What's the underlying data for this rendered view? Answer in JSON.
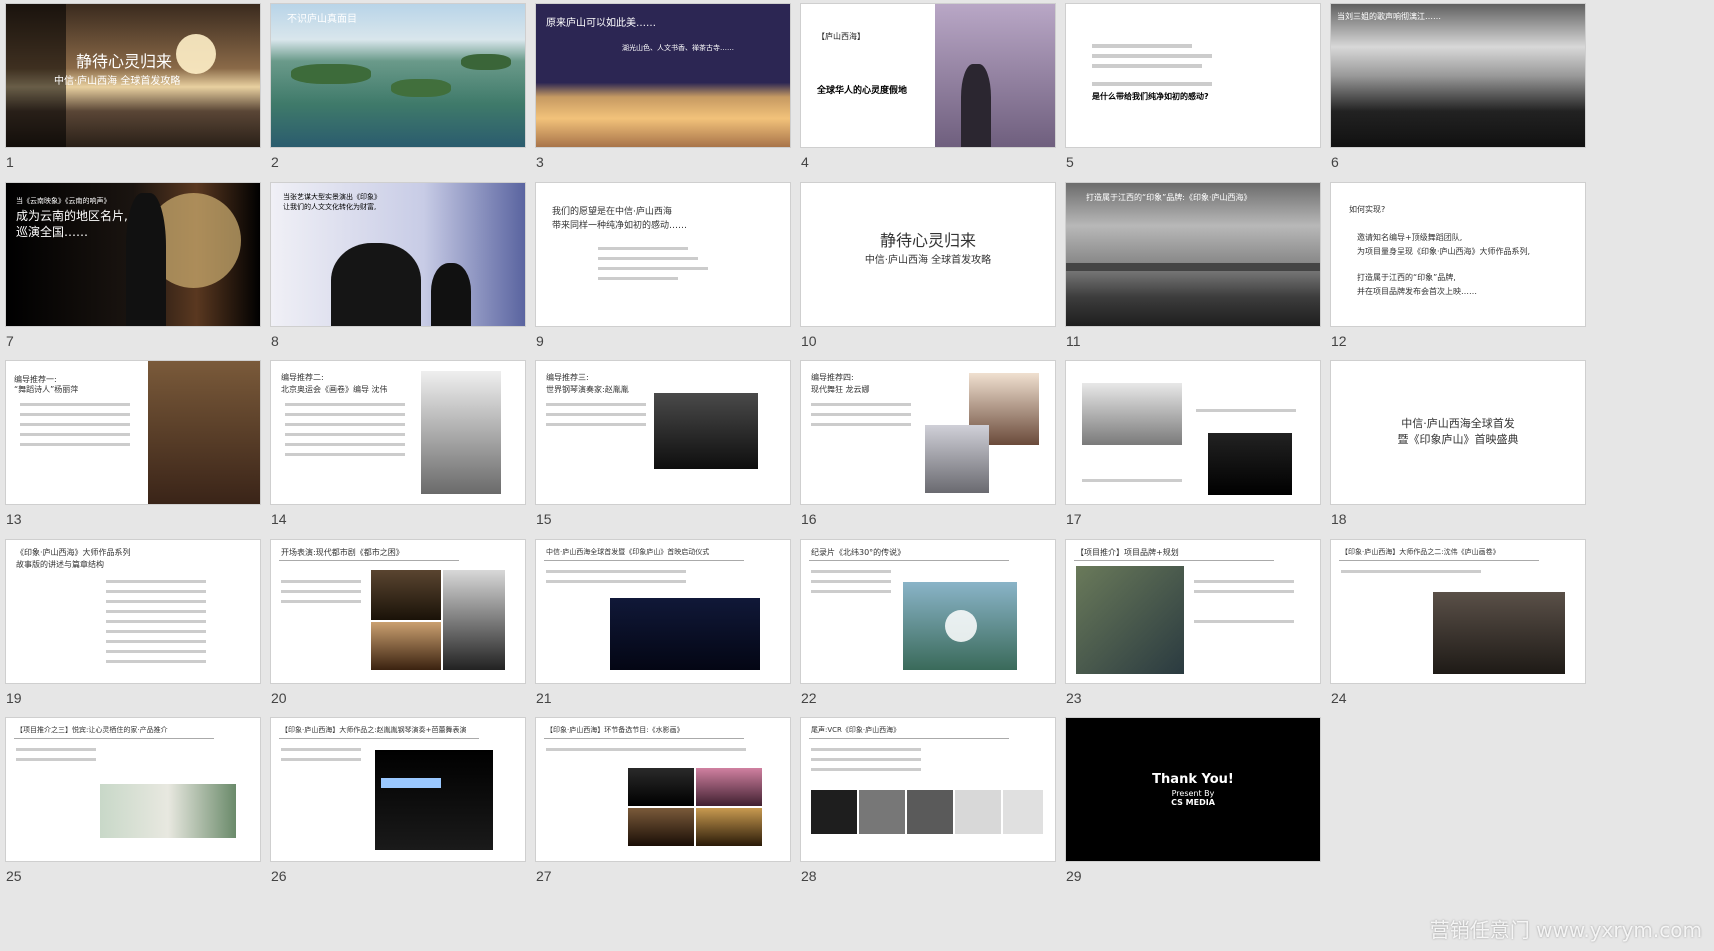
{
  "watermark": "营销任意门 www.yxrym.com",
  "slides": [
    {
      "num": "1",
      "texts": [
        "静待心灵归来",
        "中信·庐山西海 全球首发攻略"
      ]
    },
    {
      "num": "2",
      "texts": [
        "不识庐山真面目"
      ]
    },
    {
      "num": "3",
      "texts": [
        "原来庐山可以如此美……",
        "湖光山色、人文书香、禅茶古寺……"
      ]
    },
    {
      "num": "4",
      "texts": [
        "【庐山西海】",
        "全球华人的心灵度假地"
      ]
    },
    {
      "num": "5",
      "texts": [
        "是什么带给我们纯净如初的感动?"
      ]
    },
    {
      "num": "6",
      "texts": [
        "当刘三姐的歌声响彻漓江……"
      ]
    },
    {
      "num": "7",
      "texts": [
        "当《云南映象》《云南的响声》",
        "成为云南的地区名片,",
        "巡演全国……"
      ]
    },
    {
      "num": "8",
      "texts": [
        "当张艺谋大型实景演出《印象》",
        "让我们的人文文化转化为财富,"
      ]
    },
    {
      "num": "9",
      "texts": [
        "我们的愿望是在中信·庐山西海",
        "带来同样一种纯净如初的感动……"
      ]
    },
    {
      "num": "10",
      "texts": [
        "静待心灵归来",
        "中信·庐山西海 全球首发攻略"
      ]
    },
    {
      "num": "11",
      "texts": [
        "打造属于江西的“印象”品牌:《印象·庐山西海》"
      ]
    },
    {
      "num": "12",
      "texts": [
        "如何实现?",
        "邀请知名编导+顶级舞蹈团队,",
        "为项目量身呈现《印象·庐山西海》大师作品系列,",
        "打造属于江西的“印象”品牌,",
        "并在项目品牌发布会首次上映……"
      ]
    },
    {
      "num": "13",
      "texts": [
        "编导推荐一:",
        "“舞蹈诗人”杨丽萍"
      ]
    },
    {
      "num": "14",
      "texts": [
        "编导推荐二:",
        "北京奥运会《画卷》编导 沈伟"
      ]
    },
    {
      "num": "15",
      "texts": [
        "编导推荐三:",
        "世界钢琴演奏家:赵胤胤"
      ]
    },
    {
      "num": "16",
      "texts": [
        "编导推荐四:",
        "现代舞狂 龙云娜"
      ]
    },
    {
      "num": "17",
      "texts": []
    },
    {
      "num": "18",
      "texts": [
        "中信·庐山西海全球首发",
        "暨《印象庐山》首映盛典"
      ]
    },
    {
      "num": "19",
      "texts": [
        "《印象·庐山西海》大师作品系列",
        "故事版的讲述与篇章结构"
      ]
    },
    {
      "num": "20",
      "texts": [
        "开场表演:现代都市剧《都市之困》"
      ]
    },
    {
      "num": "21",
      "texts": [
        "中信·庐山西海全球首发暨《印象庐山》首映启动仪式"
      ]
    },
    {
      "num": "22",
      "texts": [
        "纪录片《北纬30°的传说》"
      ]
    },
    {
      "num": "23",
      "texts": [
        "【项目推介】项目品牌+规划"
      ]
    },
    {
      "num": "24",
      "texts": [
        "【印象·庐山西海】大师作品之二:沈伟《庐山画卷》"
      ]
    },
    {
      "num": "25",
      "texts": [
        "【项目推介之三】悦宾:让心灵栖住的家·产品推介"
      ]
    },
    {
      "num": "26",
      "texts": [
        "【印象·庐山西海】大师作品之:赵胤胤钢琴演奏+芭蕾舞表演"
      ]
    },
    {
      "num": "27",
      "texts": [
        "【印象·庐山西海】环节备选节目:《水影画》"
      ]
    },
    {
      "num": "28",
      "texts": [
        "尾声:VCR《印象·庐山西海》"
      ]
    },
    {
      "num": "29",
      "texts": [
        "Thank You!",
        "Present By",
        "CS MEDIA"
      ]
    }
  ]
}
